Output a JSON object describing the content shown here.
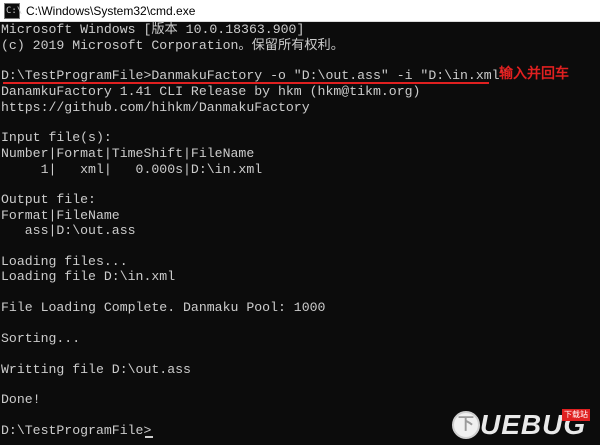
{
  "window": {
    "title": "C:\\Windows\\System32\\cmd.exe",
    "icon": "console-icon",
    "icon_glyph": "C:\\"
  },
  "console": {
    "lines": [
      "Microsoft Windows [版本 10.0.18363.900]",
      "(c) 2019 Microsoft Corporation。保留所有权利。",
      "",
      "D:\\TestProgramFile>DanmakuFactory -o \"D:\\out.ass\" -i \"D:\\in.xml\"",
      "DanamkuFactory 1.41 CLI Release by hkm (hkm@tikm.org)",
      "https://github.com/hihkm/DanmakuFactory",
      "",
      "Input file(s):",
      "Number|Format|TimeShift|FileName",
      "     1|   xml|   0.000s|D:\\in.xml",
      "",
      "Output file:",
      "Format|FileName",
      "   ass|D:\\out.ass",
      "",
      "Loading files...",
      "Loading file D:\\in.xml",
      "",
      "File Loading Complete. Danmaku Pool: 1000",
      "",
      "Sorting...",
      "",
      "Writting file D:\\out.ass",
      "",
      "Done!",
      "",
      "D:\\TestProgramFile>"
    ],
    "annotation": "输入并回车",
    "colors": {
      "background": "#0c0c0c",
      "text": "#cccccc",
      "annotation": "#e02020"
    }
  },
  "watermark": {
    "badge_glyph": "下",
    "text": "UEBUG",
    "tag": "下载站"
  }
}
